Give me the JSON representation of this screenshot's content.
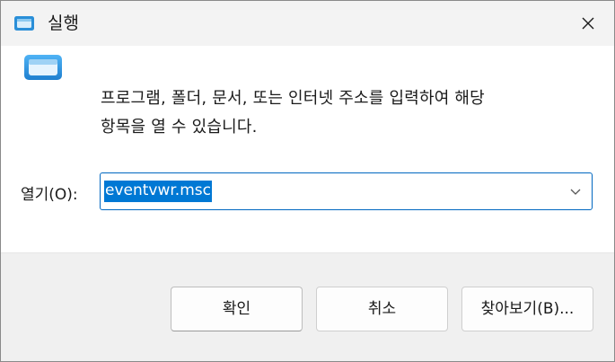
{
  "window": {
    "title": "실행",
    "close_icon": "close-icon"
  },
  "body": {
    "icon": "run-app-icon",
    "description_line1": "프로그램, 폴더, 문서, 또는 인터넷 주소를 입력하여 해당",
    "description_line2": "항목을 열 수 있습니다."
  },
  "open": {
    "label": "열기(O):",
    "value": "eventvwr.msc",
    "dropdown_icon": "chevron-down-icon"
  },
  "buttons": {
    "ok": "확인",
    "cancel": "취소",
    "browse": "찾아보기(B)..."
  },
  "colors": {
    "accent": "#0078d4",
    "titlebar": "#f3f3f3",
    "footer": "#f0f0f0"
  }
}
